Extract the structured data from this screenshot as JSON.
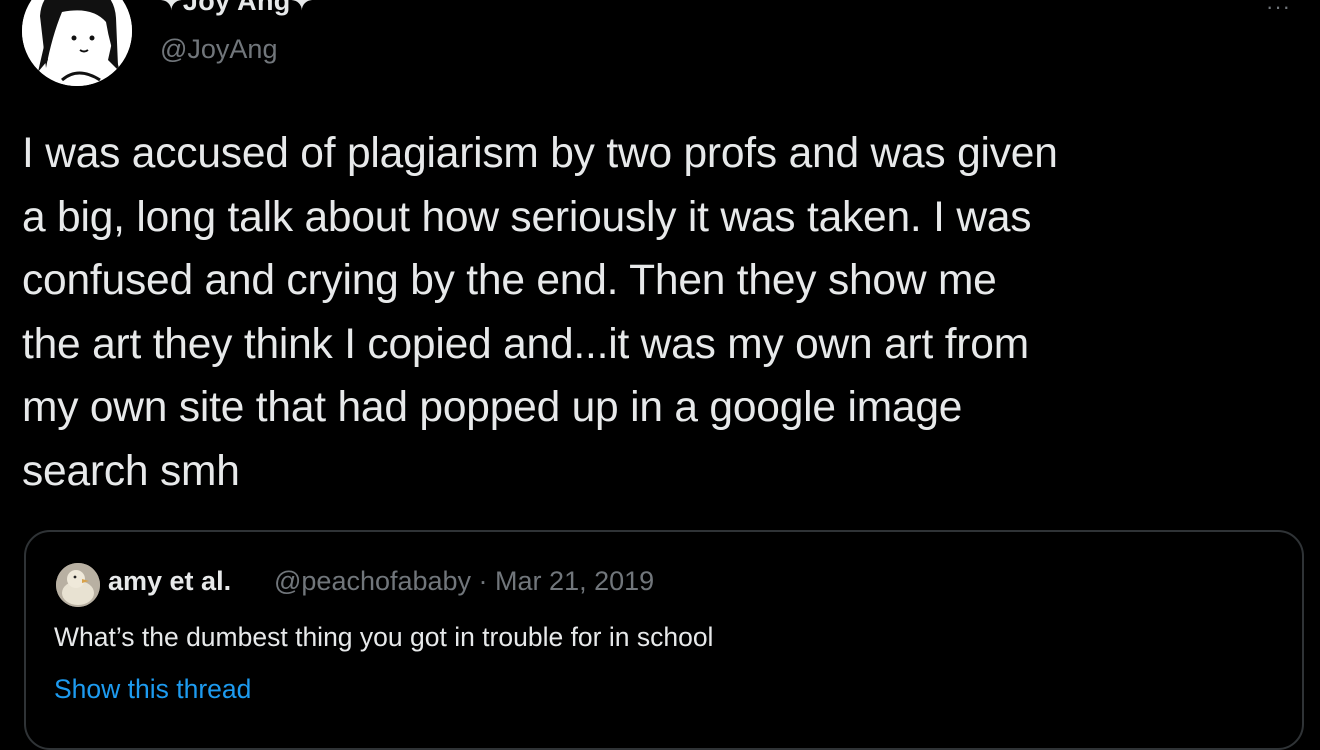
{
  "author": {
    "display_name": "✦Joy Ang✦",
    "handle": "@JoyAng",
    "more_label": "···"
  },
  "tweet": {
    "text": "I was accused of plagiarism by two profs and was given\na big, long talk about how seriously it was taken. I was\nconfused and crying by the end. Then they show me\nthe art they think I copied and...it was my own art from\nmy own site that had popped up in a google image\nsearch smh"
  },
  "quote": {
    "display_name": "amy et al.",
    "handle_date": "@peachofababy · Mar 21, 2019",
    "text": "What’s the dumbest thing you got in trouble for in school",
    "show_thread": "Show this thread"
  },
  "colors": {
    "background": "#000000",
    "primary_text": "#e7e9ea",
    "secondary_text": "#71767b",
    "border": "#2f3336",
    "link": "#1d9bf0"
  },
  "icons": {
    "author_avatar": "cartoon-girl-avatar",
    "quote_avatar": "duckling-avatar",
    "more": "more-dots-icon"
  }
}
